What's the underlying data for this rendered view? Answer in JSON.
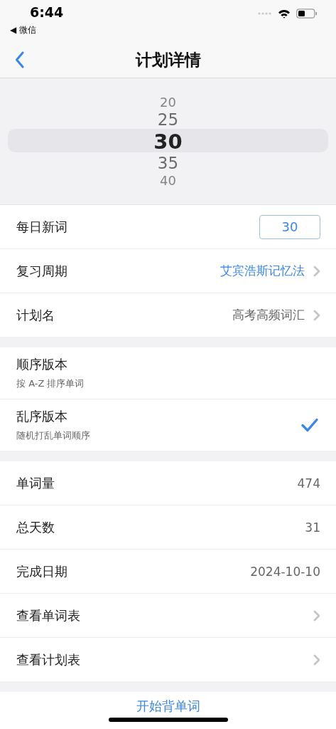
{
  "status_bar": {
    "time": "6:44",
    "back_app": "◀ 微信"
  },
  "nav_bar": {
    "title": "计划详情"
  },
  "picker": {
    "values": [
      {
        "label": "20",
        "selected": false
      },
      {
        "label": "25",
        "selected": false
      },
      {
        "label": "30",
        "selected": true
      },
      {
        "label": "35",
        "selected": false
      },
      {
        "label": "40",
        "selected": false
      }
    ]
  },
  "sections": [
    {
      "rows": [
        {
          "kind": "field",
          "label": "每日新词",
          "value": "30"
        },
        {
          "kind": "link",
          "label": "复习周期",
          "value": "艾宾浩斯记忆法",
          "accent": true
        },
        {
          "kind": "link",
          "label": "计划名",
          "value": "高考高频词汇",
          "accent": false
        }
      ]
    },
    {
      "rows": [
        {
          "kind": "option",
          "label": "顺序版本",
          "subtitle": "按 A-Z 排序单词",
          "selected": false
        },
        {
          "kind": "option",
          "label": "乱序版本",
          "subtitle": "随机打乱单词顺序",
          "selected": true
        }
      ]
    },
    {
      "rows": [
        {
          "kind": "info",
          "label": "单词量",
          "value": "474"
        },
        {
          "kind": "info",
          "label": "总天数",
          "value": "31"
        },
        {
          "kind": "info",
          "label": "完成日期",
          "value": "2024-10-10"
        },
        {
          "kind": "link",
          "label": "查看单词表"
        },
        {
          "kind": "link",
          "label": "查看计划表"
        }
      ]
    }
  ],
  "action_button": {
    "label": "开始背单词"
  }
}
